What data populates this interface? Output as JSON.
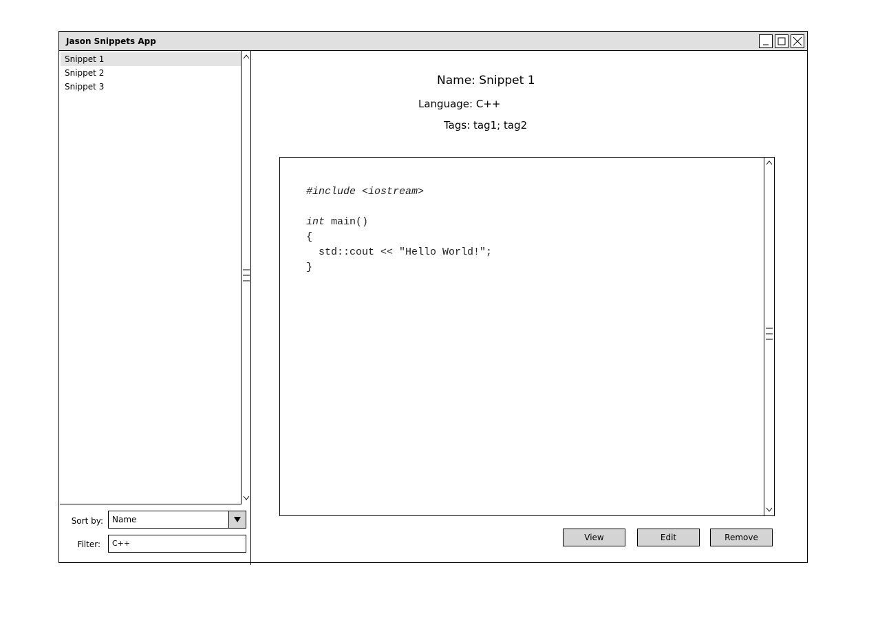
{
  "window": {
    "title": "Jason Snippets App"
  },
  "snippet_list": {
    "items": [
      {
        "label": "Snippet 1",
        "selected": true
      },
      {
        "label": "Snippet 2",
        "selected": false
      },
      {
        "label": "Snippet 3",
        "selected": false
      }
    ]
  },
  "sort": {
    "label": "Sort by:",
    "value": "Name"
  },
  "filter": {
    "label": "Filter:",
    "value": "C++"
  },
  "details": {
    "name_label": "Name:",
    "name_value": "Snippet 1",
    "language_label": "Language:",
    "language_value": "C++",
    "tags_label": "Tags:",
    "tags_value": "tag1; tag2"
  },
  "code": {
    "include_kw": "#include",
    "include_rest": " <iostream>",
    "main_kw": "int",
    "main_rest": " main()",
    "open_brace": "{",
    "body": "  std::cout << \"Hello World!\";",
    "close_brace": "}"
  },
  "actions": {
    "view_label": "View",
    "edit_label": "Edit",
    "remove_label": "Remove"
  },
  "icons": [
    "minimize-icon",
    "maximize-icon",
    "close-icon",
    "scroll-up-icon",
    "scroll-down-icon",
    "scroll-grip-icon",
    "dropdown-arrow-icon"
  ]
}
